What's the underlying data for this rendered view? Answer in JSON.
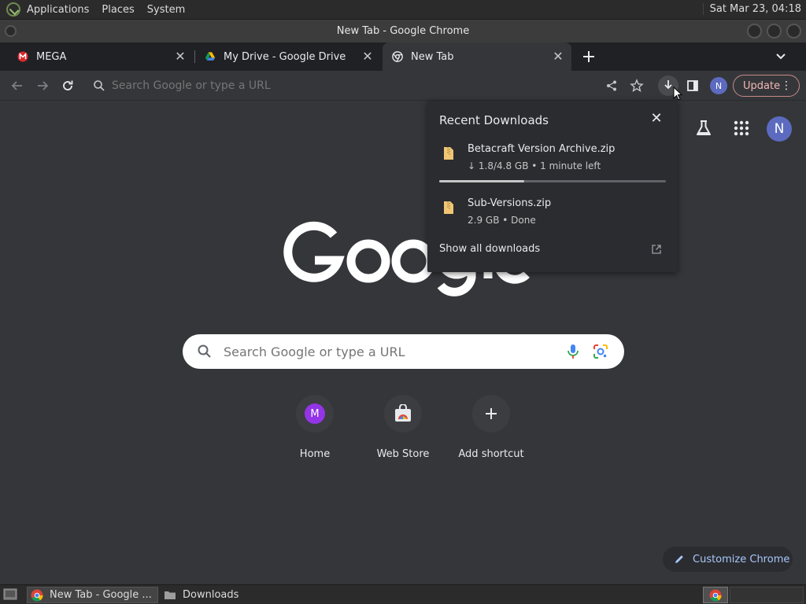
{
  "desktop": {
    "menus": [
      "Applications",
      "Places",
      "System"
    ],
    "clock": "Sat Mar 23, 04:18"
  },
  "window": {
    "title": "New Tab - Google Chrome"
  },
  "tabs": [
    {
      "label": "MEGA",
      "active": false
    },
    {
      "label": "My Drive - Google Drive",
      "active": false
    },
    {
      "label": "New Tab",
      "active": true
    }
  ],
  "toolbar": {
    "omnibox_placeholder": "Search Google or type a URL",
    "profile_initial": "N",
    "update_label": "Update"
  },
  "downloads": {
    "title": "Recent Downloads",
    "items": [
      {
        "name": "Betacraft Version Archive.zip",
        "status": "↓ 1.8/4.8 GB • 1 minute left",
        "progress": 0.375
      },
      {
        "name": "Sub-Versions.zip",
        "status": "2.9 GB • Done"
      }
    ],
    "show_all": "Show all downloads"
  },
  "ntp": {
    "avatar_initial": "N",
    "search_placeholder": "Search Google or type a URL",
    "shortcuts": [
      {
        "label": "Home",
        "initial": "M"
      },
      {
        "label": "Web Store"
      },
      {
        "label": "Add shortcut"
      }
    ],
    "customize_label": "Customize Chrome"
  },
  "taskbar": {
    "items": [
      "New Tab - Google ...",
      "Downloads"
    ]
  },
  "colors": {
    "accent_blue": "#a8c7fa",
    "avatar": "#5c6bc0",
    "update_border": "#c58b87",
    "home_shortcut": "#9334e6"
  }
}
